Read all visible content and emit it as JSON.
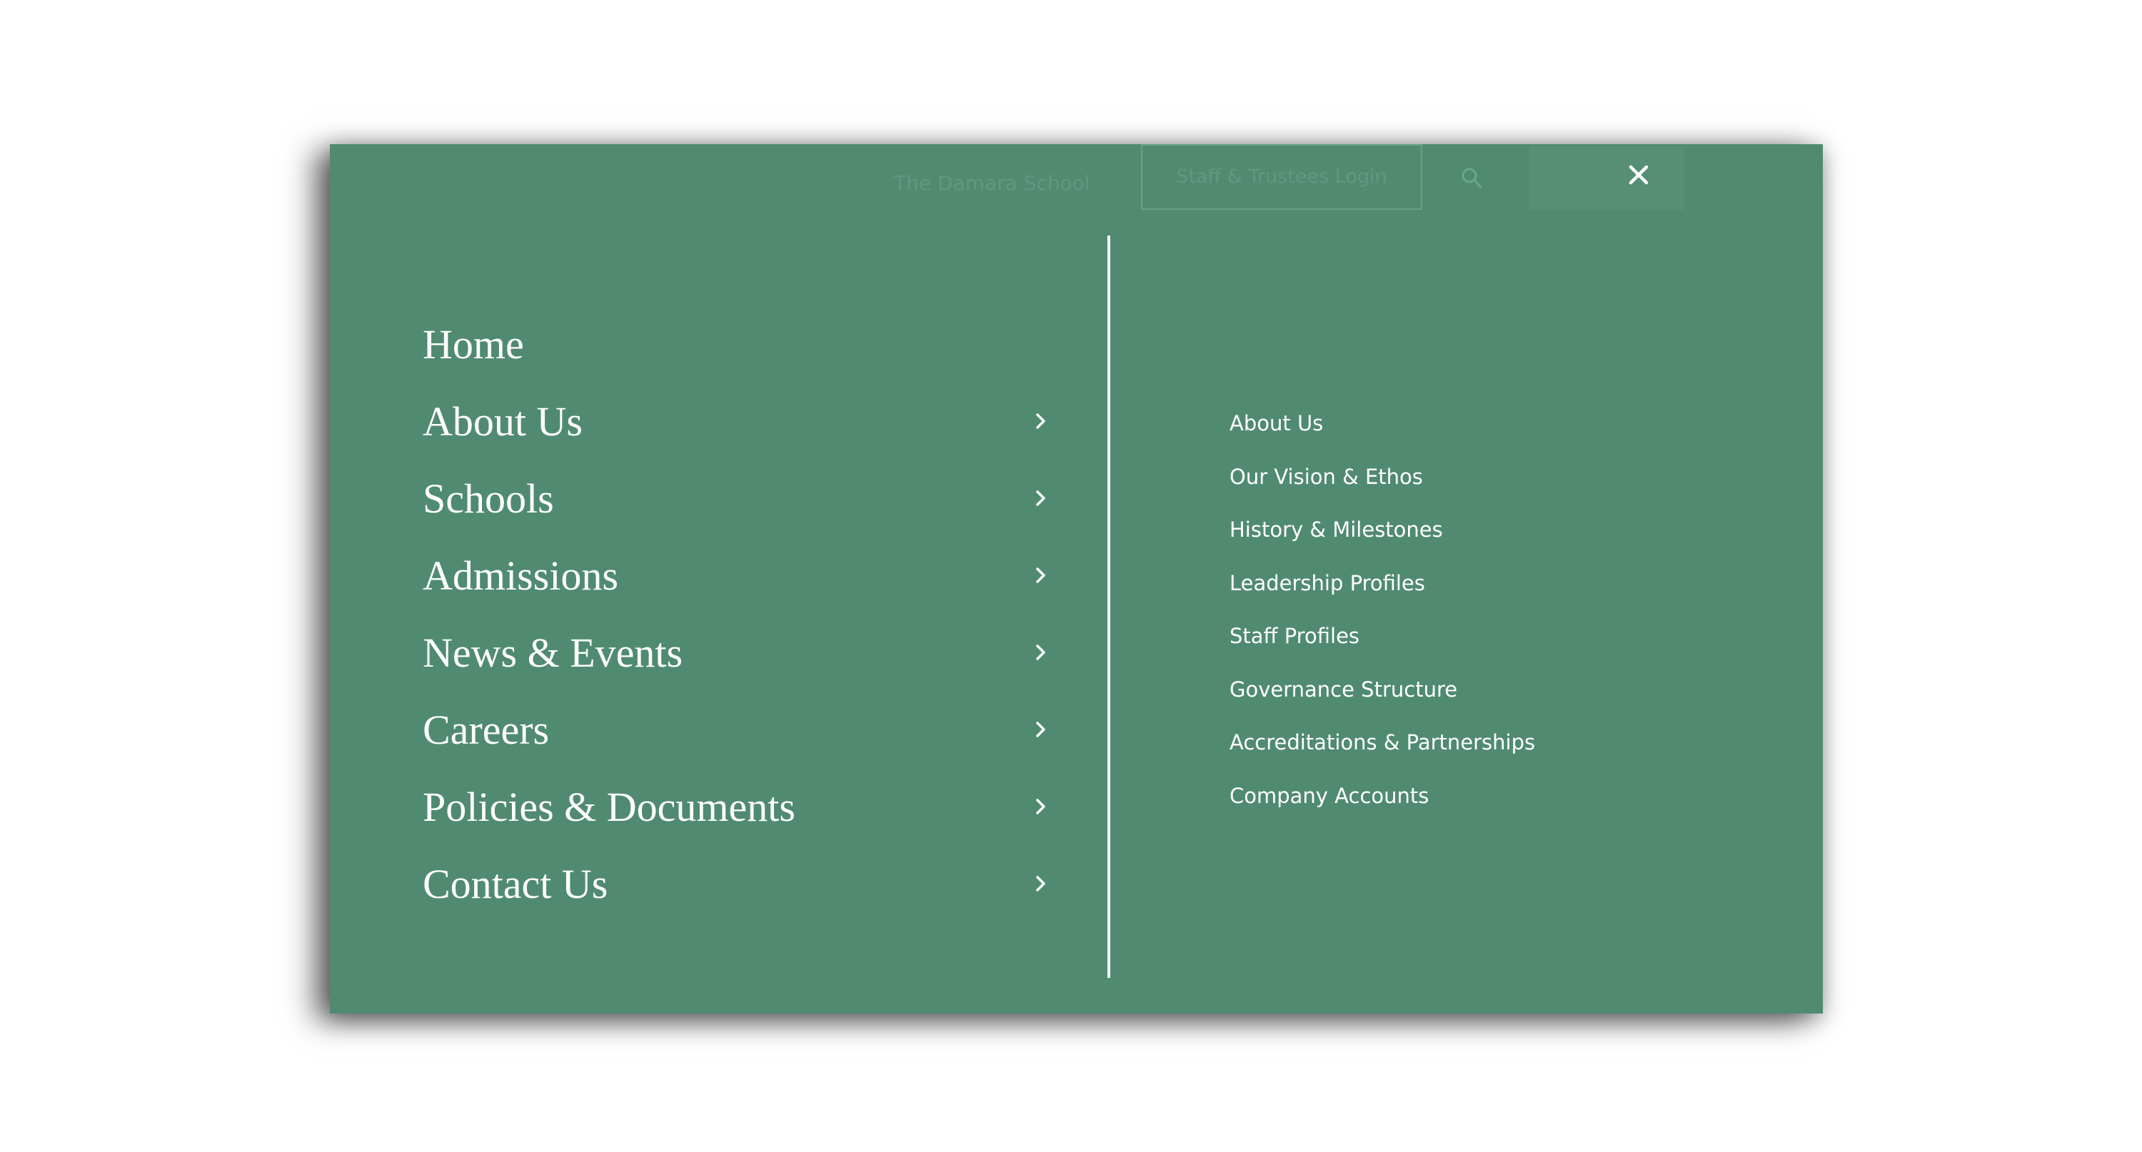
{
  "topbar": {
    "school_link": "The Damara School",
    "login_label": "Staff & Trustees Login"
  },
  "main_menu": {
    "items": [
      {
        "label": "Home",
        "has_submenu": false
      },
      {
        "label": "About Us",
        "has_submenu": true
      },
      {
        "label": "Schools",
        "has_submenu": true
      },
      {
        "label": "Admissions",
        "has_submenu": true
      },
      {
        "label": "News & Events",
        "has_submenu": true
      },
      {
        "label": "Careers",
        "has_submenu": true
      },
      {
        "label": "Policies & Documents",
        "has_submenu": true
      },
      {
        "label": "Contact Us",
        "has_submenu": true
      }
    ]
  },
  "sub_menu": {
    "items": [
      "About Us",
      "Our Vision & Ethos",
      "History & Milestones",
      "Leadership Profiles",
      "Staff Profiles",
      "Governance Structure",
      "Accreditations & Partnerships",
      "Company Accounts"
    ]
  },
  "icons": {
    "search": "search-icon",
    "close": "close-icon",
    "chevron": "chevron-right-icon"
  },
  "colors": {
    "panel_background": "#508b71",
    "text": "#ffffff",
    "faded_text": "#5f9880"
  }
}
